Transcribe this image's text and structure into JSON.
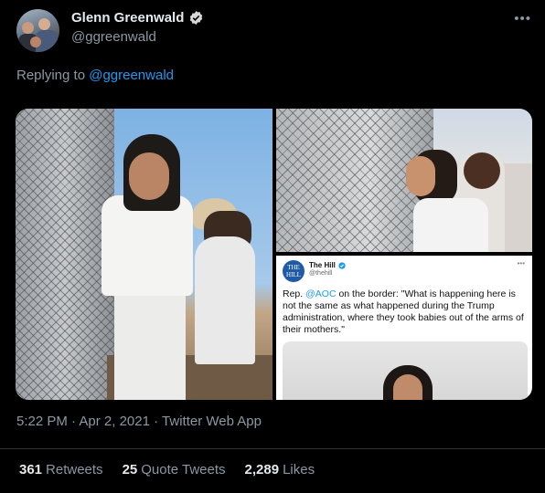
{
  "author": {
    "name": "Glenn Greenwald",
    "handle": "@ggreenwald",
    "verified": true,
    "avatar": "avatar"
  },
  "more_icon": "ellipsis-icon",
  "reply": {
    "prefix": "Replying to",
    "mention": "@ggreenwald"
  },
  "embedded_tweet": {
    "logo_text": "THE HILL",
    "name": "The Hill",
    "handle": "@thehill",
    "text_prefix": "Rep. ",
    "mention": "@AOC",
    "text_body": " on the border: \"What is happening here is not the same as what happened during the Trump administration, where they took babies out of the arms of their mothers.\""
  },
  "timestamp": {
    "time": "5:22 PM",
    "separator": "·",
    "date": "Apr 2, 2021",
    "source": "Twitter Web App"
  },
  "stats": {
    "retweets_count": "361",
    "retweets_label": "Retweets",
    "quotes_count": "25",
    "quotes_label": "Quote Tweets",
    "likes_count": "2,289",
    "likes_label": "Likes"
  },
  "colors": {
    "background": "#000000",
    "link": "#1d9bf0",
    "secondary_text": "#8b98a5",
    "primary_text": "#e7e9ea"
  }
}
